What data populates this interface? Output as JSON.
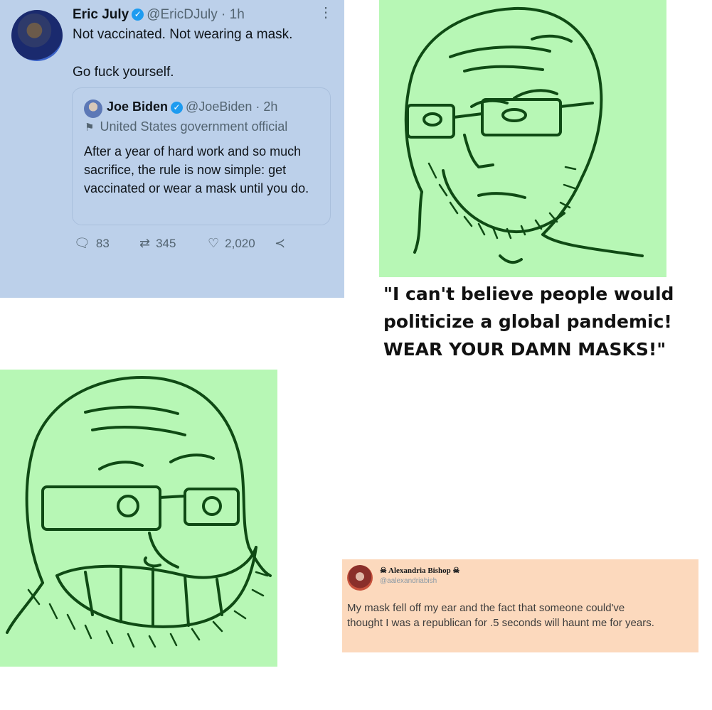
{
  "tweet1": {
    "name": "Eric July",
    "handle": "@EricDJuly",
    "time": "· 1h",
    "line1": "Not vaccinated. Not wearing a mask.",
    "line2": "Go fuck yourself.",
    "quote": {
      "name": "Joe Biden",
      "handle": "@JoeBiden",
      "time": "· 2h",
      "label": "United States government official",
      "text": "After a year of hard work and so much sacrifice, the rule is now simple: get vaccinated or wear a mask until you do."
    },
    "replies": "83",
    "retweets": "345",
    "likes": "2,020"
  },
  "caption": "\"I can't believe people would politicize a global pandemic! WEAR YOUR DAMN MASKS!\"",
  "tweet2": {
    "name": "Alexandria Bishop",
    "handle": "@aalexandriabish",
    "text": "My mask fell off my ear and the fact that someone could've thought I was a republican for .5 seconds will haunt me for years."
  },
  "colors": {
    "tweet1_bg": "#bcd0ea",
    "wojak_bg": "#b7f7b5",
    "wojak_line": "#0f4a14",
    "tweet2_bg": "#fcd9bd",
    "verified": "#1d9bf0"
  },
  "icons": [
    "avatar",
    "verified-badge-icon",
    "more-dots-icon",
    "flag-icon",
    "reply-icon",
    "retweet-icon",
    "like-icon",
    "share-icon",
    "skull-icon"
  ]
}
